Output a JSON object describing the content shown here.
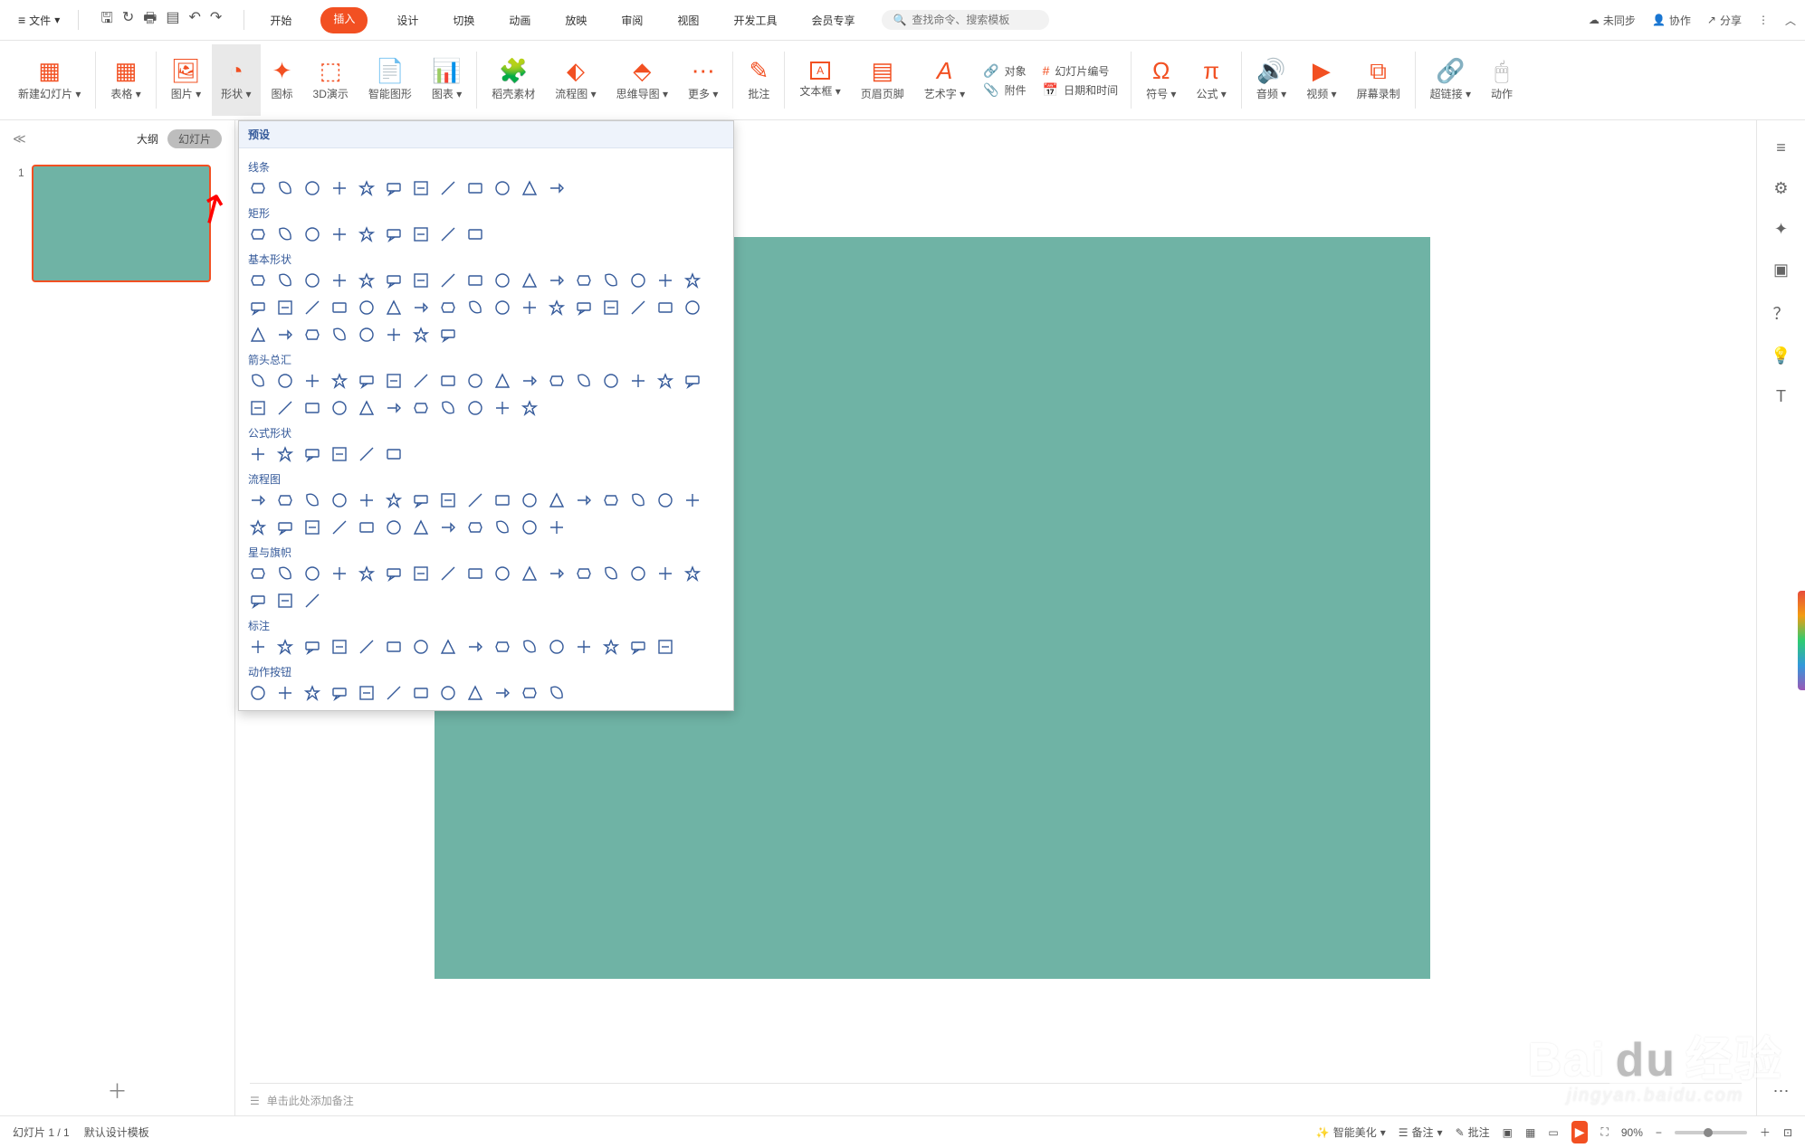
{
  "menubar": {
    "file_label": "文件",
    "tabs": [
      "开始",
      "插入",
      "设计",
      "切换",
      "动画",
      "放映",
      "审阅",
      "视图",
      "开发工具",
      "会员专享"
    ],
    "active_tab_index": 1,
    "search_placeholder": "查找命令、搜索模板",
    "right": {
      "unsync": "未同步",
      "collab": "协作",
      "share": "分享"
    }
  },
  "ribbon": {
    "new_slide": "新建幻灯片",
    "table": "表格",
    "image": "图片",
    "shape": "形状",
    "icon": "图标",
    "threeD": "3D演示",
    "smart": "智能图形",
    "chart": "图表",
    "docer": "稻壳素材",
    "flow": "流程图",
    "mind": "思维导图",
    "more": "更多",
    "comment": "批注",
    "textbox": "文本框",
    "header": "页眉页脚",
    "wordart": "艺术字",
    "object": "对象",
    "slide_num": "幻灯片编号",
    "attach": "附件",
    "datetime": "日期和时间",
    "symbol": "符号",
    "formula": "公式",
    "audio": "音频",
    "video": "视频",
    "screen": "屏幕录制",
    "hyperlink": "超链接",
    "action": "动作"
  },
  "left": {
    "outline": "大纲",
    "slides": "幻灯片",
    "num": "1"
  },
  "notes_placeholder": "单击此处添加备注",
  "shapes": {
    "header": "预设",
    "sections": {
      "lines": "线条",
      "rects": "矩形",
      "basic": "基本形状",
      "arrows": "箭头总汇",
      "equation": "公式形状",
      "flow": "流程图",
      "stars": "星与旗帜",
      "callouts": "标注",
      "actions": "动作按钮"
    },
    "counts": {
      "lines": 12,
      "rects": 9,
      "basic": 42,
      "arrows": 28,
      "equation": 6,
      "flow": 29,
      "stars": 20,
      "callouts": 16,
      "actions": 12
    }
  },
  "status": {
    "page": "幻灯片 1 / 1",
    "template": "默认设计模板",
    "beautify": "智能美化",
    "notes": "备注",
    "comments": "批注",
    "zoom": "90%"
  },
  "watermark": {
    "brand_a": "Bai",
    "brand_b": "du",
    "brand_c": "经验",
    "sub": "jingyan.baidu.com"
  }
}
